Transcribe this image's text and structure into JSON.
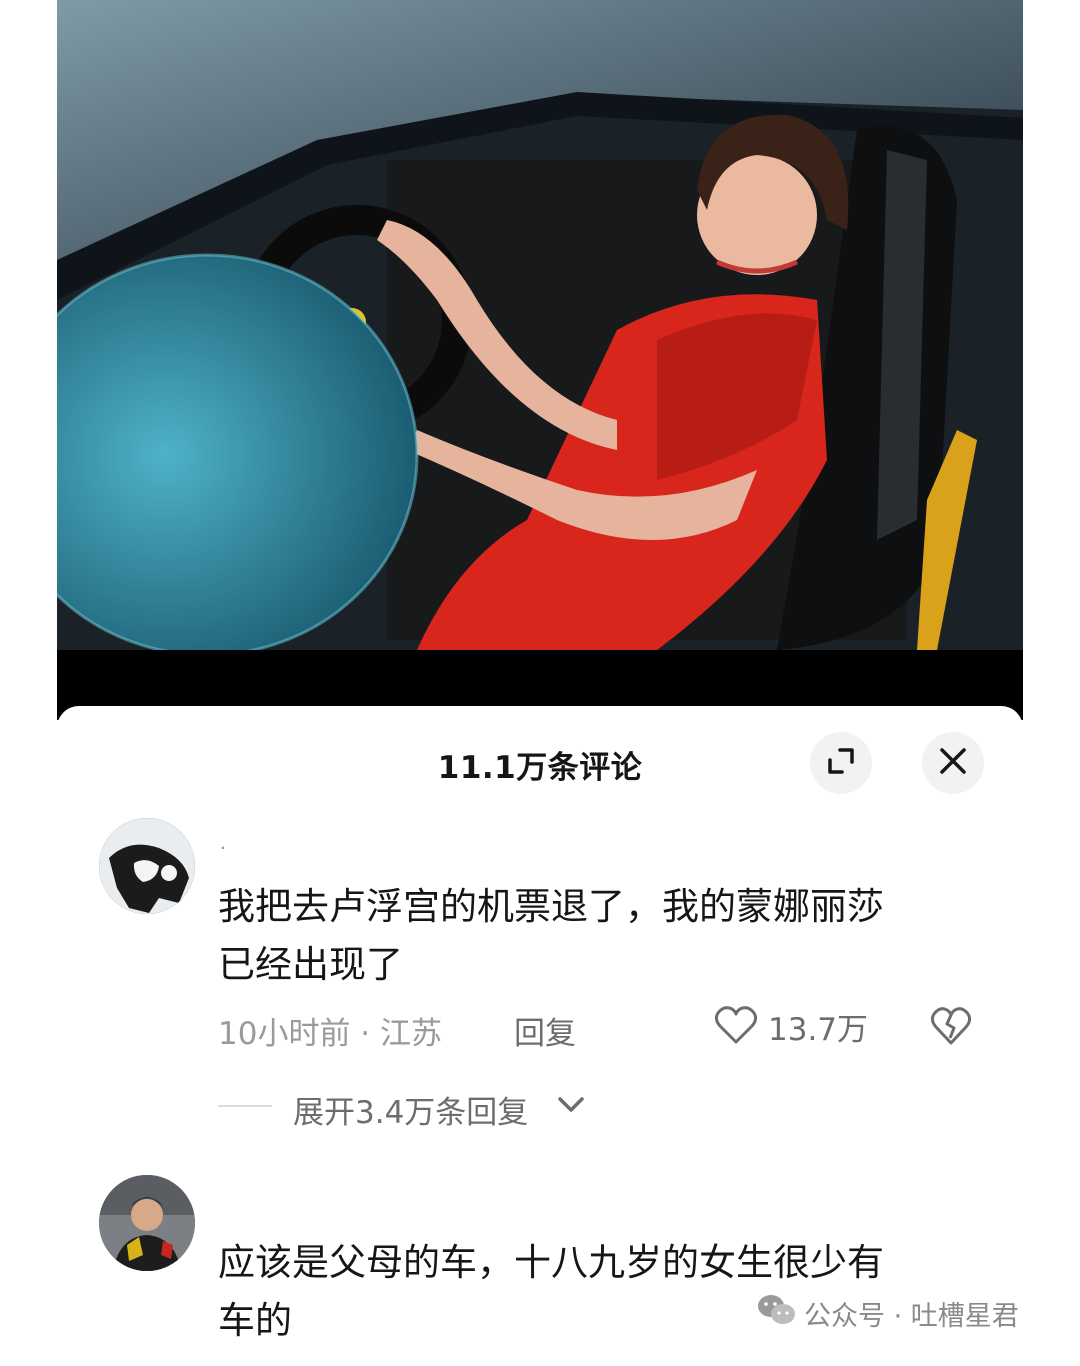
{
  "video": {
    "description_icon": "car-photo"
  },
  "sheet": {
    "title": "11.1万条评论",
    "expand_icon": "expand-icon",
    "close_icon": "close-icon"
  },
  "comments": [
    {
      "username": "·",
      "text_line1": "我把去卢浮宫的机票退了，我的蒙娜丽莎",
      "text_line2": "已经出现了",
      "time_location": "10小时前 · 江苏",
      "reply_label": "回复",
      "likes": "13.7万",
      "expand_replies": "展开3.4万条回复"
    },
    {
      "text_line1": "应该是父母的车，十八九岁的女生很少有",
      "text_line2": "车的"
    }
  ],
  "watermark": {
    "text": "公众号 · 吐槽星君"
  },
  "colors": {
    "accent_red": "#d9261c",
    "text_primary": "#161616",
    "text_secondary": "#9a9a9a"
  }
}
